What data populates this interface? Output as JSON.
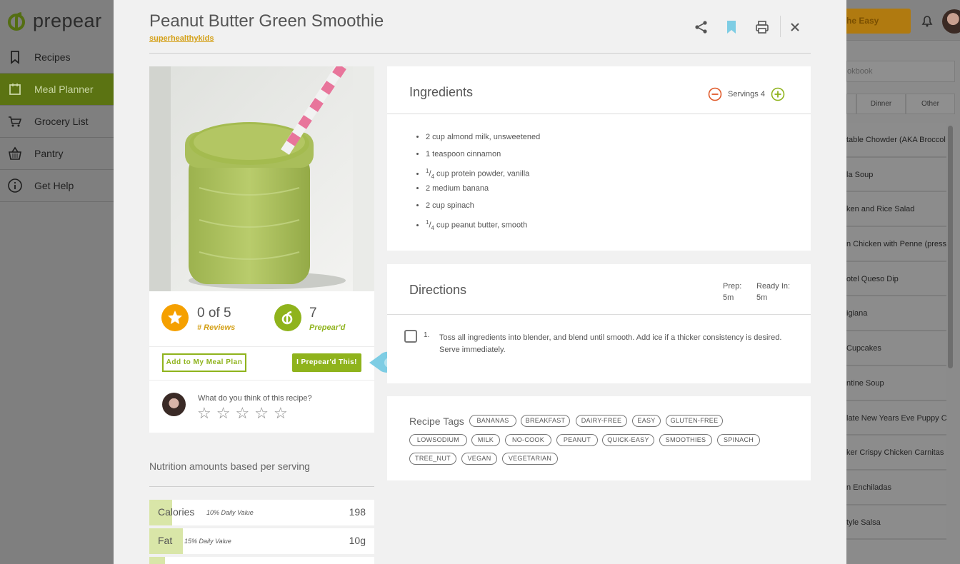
{
  "app": {
    "logo_text": "prepear"
  },
  "sidebar": {
    "items": [
      {
        "label": "Recipes",
        "icon": "bookmark-icon"
      },
      {
        "label": "Meal Planner",
        "icon": "calendar-icon",
        "active": true
      },
      {
        "label": "Grocery List",
        "icon": "cart-icon"
      },
      {
        "label": "Pantry",
        "icon": "basket-icon"
      },
      {
        "label": "Get Help",
        "icon": "info-icon"
      }
    ]
  },
  "background_app": {
    "button_label": "the Easy",
    "search_placeholder": "okbook",
    "tabs": [
      "Dinner",
      "Other"
    ],
    "recipes": [
      "table Chowder (AKA Broccol",
      "la Soup",
      "ken and Rice Salad",
      "n Chicken with Penne (pressu",
      "otel Queso Dip",
      "igiana",
      "Cupcakes",
      "ntine Soup",
      "late New Years Eve Puppy Cl",
      "ker Crispy Chicken Carnitas",
      "n Enchiladas",
      "tyle Salsa"
    ]
  },
  "recipe": {
    "title": "Peanut Butter Green Smoothie",
    "source": "superhealthykids",
    "rating": {
      "value": "0 of 5",
      "label": "# Reviews"
    },
    "prepeard": {
      "count": "7",
      "label": "Prepear'd"
    },
    "add_meal_plan_label": "Add to My Meal Plan",
    "prepeard_button_label": "I Prepear'd This!",
    "review_question": "What do you think of this recipe?",
    "stars": [
      "☆",
      "☆",
      "☆",
      "☆",
      "☆"
    ],
    "ingredients_title": "Ingredients",
    "servings_label": "Servings 4",
    "ingredients": [
      {
        "qty": "2 cup",
        "text": "almond milk, unsweetened"
      },
      {
        "qty": "1 teaspoon",
        "text": "cinnamon"
      },
      {
        "frac_num": "1",
        "frac_den": "4",
        "text": "cup protein powder, vanilla"
      },
      {
        "qty": "2 medium",
        "text": "banana"
      },
      {
        "qty": "2 cup",
        "text": "spinach"
      },
      {
        "frac_num": "1",
        "frac_den": "4",
        "text": "cup peanut butter, smooth"
      }
    ],
    "directions_title": "Directions",
    "prep_label": "Prep:",
    "prep_value": "5m",
    "ready_label": "Ready In:",
    "ready_value": "5m",
    "steps": [
      {
        "num": "1.",
        "text": "Toss all ingredients into blender, and blend until smooth. Add ice if a thicker consistency is desired. Serve immediately."
      }
    ],
    "tags_title": "Recipe Tags",
    "tags": [
      "BANANAS",
      "BREAKFAST",
      "DAIRY-FREE",
      "EASY",
      "GLUTEN-FREE",
      "LOWSODIUM",
      "MILK",
      "NO-COOK",
      "PEANUT",
      "QUICK-EASY",
      "SMOOTHIES",
      "SPINACH",
      "TREE_NUT",
      "VEGAN",
      "VEGETARIAN"
    ],
    "nutrition_title": "Nutrition amounts based per serving",
    "nutrition": [
      {
        "name": "Calories",
        "dv": "10% Daily Value",
        "value": "198",
        "pct": 10
      },
      {
        "name": "Fat",
        "dv": "15% Daily Value",
        "value": "10g",
        "pct": 15
      },
      {
        "name": "",
        "dv": "",
        "value": "",
        "pct": 7
      }
    ]
  },
  "colors": {
    "brand_green": "#8fb31c",
    "sidebar_active": "#5b7312",
    "star_orange": "#f5a000",
    "bookmark_blue": "#7ecde4",
    "source_gold": "#d4a017",
    "minus_red": "#e05a2a"
  }
}
